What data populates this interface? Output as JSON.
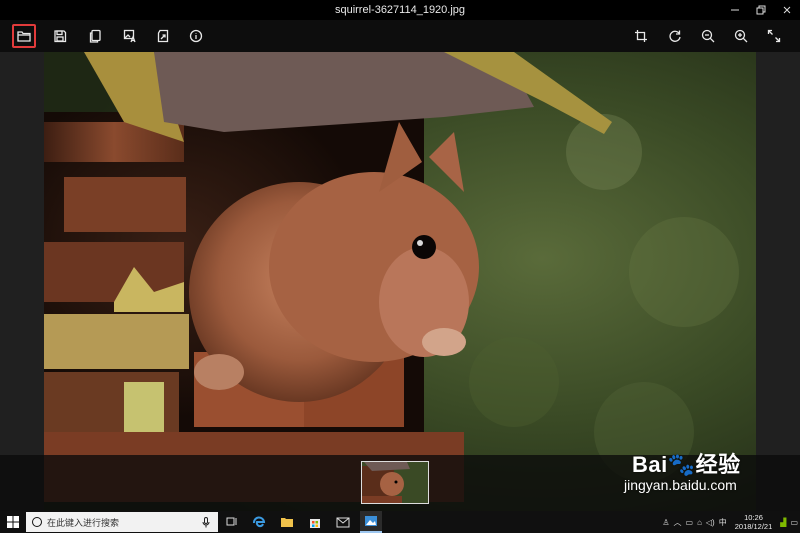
{
  "window": {
    "title": "squirrel-3627114_1920.jpg",
    "controls": [
      "minimize",
      "restore",
      "close"
    ]
  },
  "toolbar": {
    "left_icons": [
      "open-folder-icon",
      "save-icon",
      "copy-icon",
      "image-edit-icon",
      "export-icon",
      "info-icon"
    ],
    "right_icons": [
      "crop-icon",
      "rotate-icon",
      "zoom-out-icon",
      "zoom-in-icon",
      "fullscreen-icon"
    ],
    "active": "open-folder-icon"
  },
  "watermark": {
    "brand": "Bai🐾经验",
    "url": "jingyan.baidu.com"
  },
  "taskbar": {
    "search_placeholder": "在此键入进行搜索",
    "ime": "中",
    "time": "10:26",
    "date": "2018/12/21"
  },
  "colors": {
    "active_outline": "#e23b3b",
    "taskbar": "#101010"
  }
}
